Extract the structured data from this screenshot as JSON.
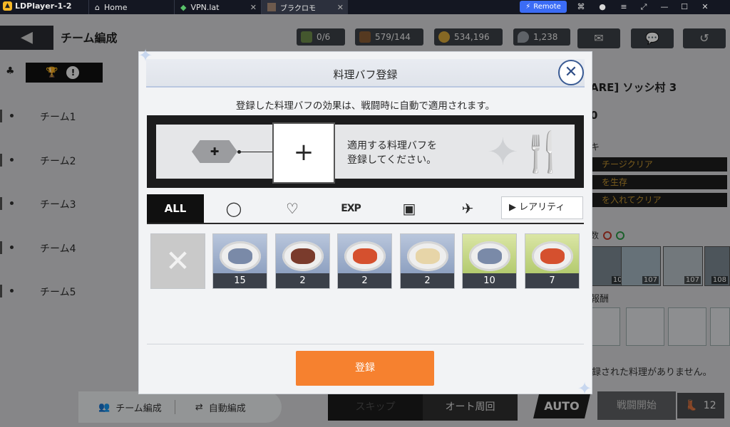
{
  "window": {
    "app_name": "LDPlayer-1-2",
    "tabs": [
      {
        "label": "Home"
      },
      {
        "label": "VPN.lat"
      },
      {
        "label": "ブラクロモ"
      }
    ],
    "remote_label": "Remote"
  },
  "game": {
    "title": "チーム編成",
    "resources": {
      "cards": "0/6",
      "stamina": "579/144",
      "gold": "534,196",
      "crystal": "1,238"
    },
    "teams": [
      "チーム1",
      "チーム2",
      "チーム3",
      "チーム4",
      "チーム5"
    ],
    "bottom_left": {
      "formation": "チーム編成",
      "auto_formation": "自動編成"
    },
    "skip_label": "スキップ",
    "auto_loop_label": "オート周回",
    "auto_tag": "AUTO",
    "start_label": "戦闘開始",
    "start_cost": "12",
    "right_panel": {
      "title_fragment": "ARE] ソッシ村 3",
      "zero_fragment": "0",
      "ki_fragment": "キ",
      "conditions": [
        "チージクリア",
        "を生存",
        "を入れてクリア"
      ],
      "num_fragment": "数",
      "characters": [
        {
          "level": "108"
        },
        {
          "level": "107"
        },
        {
          "level": "107"
        },
        {
          "level": "108"
        }
      ],
      "reward_fragment": "報酬",
      "no_food_text": "録された料理がありません。"
    }
  },
  "modal": {
    "title": "料理バフ登録",
    "close_icon": "close-icon",
    "description": "登録した料理バフの効果は、戦闘時に自動で適用されます。",
    "register_hint_line1": "適用する料理バフを",
    "register_hint_line2": "登録してください。",
    "filters": {
      "all": "ALL",
      "exp": "EXP",
      "rarity": "レアリティ"
    },
    "foods": [
      {
        "name": "none",
        "count": ""
      },
      {
        "name": "grilled-fish",
        "count": "15",
        "bg": "blue"
      },
      {
        "name": "roast-meat",
        "count": "2",
        "bg": "blue"
      },
      {
        "name": "sandwich",
        "count": "2",
        "bg": "blue"
      },
      {
        "name": "dumpling",
        "count": "2",
        "bg": "blue"
      },
      {
        "name": "grilled-fish",
        "count": "10",
        "bg": "green"
      },
      {
        "name": "sandwich",
        "count": "7",
        "bg": "green"
      }
    ],
    "register_button": "登録"
  },
  "colors": {
    "accent_orange": "#f6812f",
    "modal_bg": "#f2f3f5",
    "close_blue": "#2e4d86",
    "food_blue": "#7d92b6",
    "food_green": "#a4c05a"
  }
}
